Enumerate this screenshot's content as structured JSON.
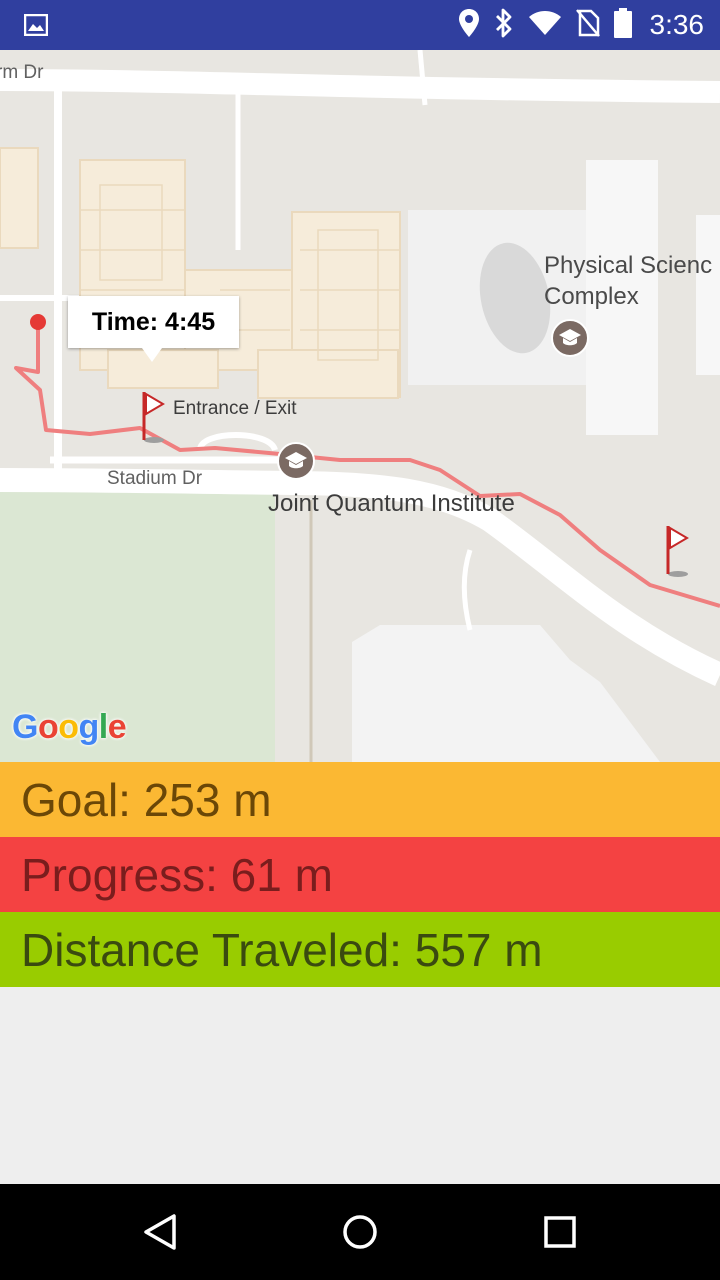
{
  "status_bar": {
    "time": "3:36",
    "icons": [
      "image-icon",
      "location-icon",
      "bluetooth-icon",
      "wifi-icon",
      "no-sim-icon",
      "battery-icon"
    ]
  },
  "map": {
    "labels": {
      "farm_dr": "rm Dr",
      "stadium_dr": "Stadium Dr",
      "entrance": "Entrance / Exit",
      "psc_line1": "Physical Scienc",
      "psc_line2": "Complex",
      "jqi": "Joint Quantum Institute"
    },
    "info_window": {
      "text": "Time: 4:45"
    },
    "google_logo": "Google",
    "colors": {
      "route": "#ef7f7f",
      "marker": "#e53935",
      "flag": "#d32f2f",
      "poi": "#7b6a63"
    }
  },
  "stats": {
    "goal": "Goal: 253 m",
    "progress": "Progress: 61 m",
    "distance": "Distance Traveled: 557 m"
  },
  "nav_bar": {
    "buttons": [
      "back",
      "home",
      "recents"
    ]
  }
}
